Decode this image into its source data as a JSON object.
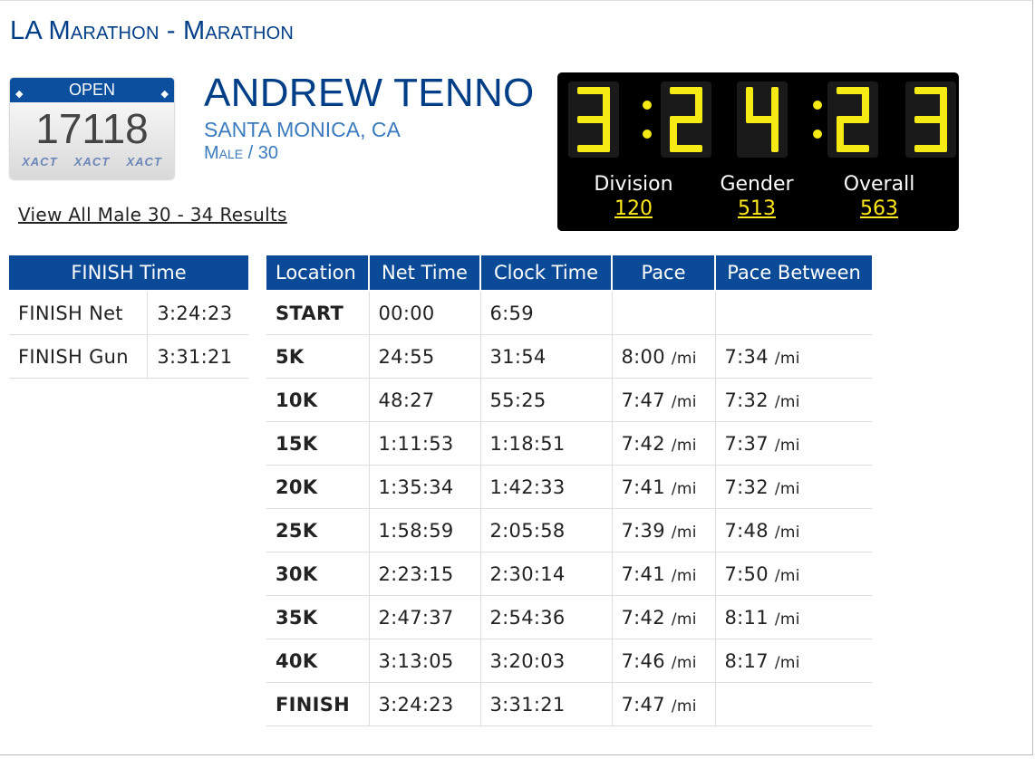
{
  "race": {
    "title": "LA Marathon - Marathon"
  },
  "bib": {
    "category": "OPEN",
    "number": "17118",
    "logos": [
      "XACT",
      "XACT",
      "XACT"
    ]
  },
  "runner": {
    "name": "ANDREW TENNO",
    "city": "SANTA MONICA, CA",
    "info": "Male / 30",
    "view_all_link": "View All Male 30 - 34 Results"
  },
  "clock": {
    "time": "3:24:23",
    "digits": [
      "3",
      "2",
      "4",
      "2",
      "3"
    ],
    "colors": {
      "segment": "#f5ea14",
      "background": "#000000",
      "rank_value": "#ffe81a"
    }
  },
  "ranks": [
    {
      "label": "Division",
      "value": "120"
    },
    {
      "label": "Gender",
      "value": "513"
    },
    {
      "label": "Overall",
      "value": "563"
    }
  ],
  "finish_time": {
    "header": "FINISH Time",
    "rows": [
      {
        "label": "FINISH Net",
        "value": "3:24:23"
      },
      {
        "label": "FINISH Gun",
        "value": "3:31:21"
      }
    ]
  },
  "splits": {
    "headers": [
      "Location",
      "Net Time",
      "Clock Time",
      "Pace",
      "Pace Between"
    ],
    "unit": "/mi",
    "rows": [
      {
        "location": "START",
        "net": "00:00",
        "clock": "6:59",
        "pace": "",
        "between": ""
      },
      {
        "location": "5K",
        "net": "24:55",
        "clock": "31:54",
        "pace": "8:00",
        "between": "7:34"
      },
      {
        "location": "10K",
        "net": "48:27",
        "clock": "55:25",
        "pace": "7:47",
        "between": "7:32"
      },
      {
        "location": "15K",
        "net": "1:11:53",
        "clock": "1:18:51",
        "pace": "7:42",
        "between": "7:37"
      },
      {
        "location": "20K",
        "net": "1:35:34",
        "clock": "1:42:33",
        "pace": "7:41",
        "between": "7:32"
      },
      {
        "location": "25K",
        "net": "1:58:59",
        "clock": "2:05:58",
        "pace": "7:39",
        "between": "7:48"
      },
      {
        "location": "30K",
        "net": "2:23:15",
        "clock": "2:30:14",
        "pace": "7:41",
        "between": "7:50"
      },
      {
        "location": "35K",
        "net": "2:47:37",
        "clock": "2:54:36",
        "pace": "7:42",
        "between": "8:11"
      },
      {
        "location": "40K",
        "net": "3:13:05",
        "clock": "3:20:03",
        "pace": "7:46",
        "between": "8:17"
      },
      {
        "location": "FINISH",
        "net": "3:24:23",
        "clock": "3:31:21",
        "pace": "7:47",
        "between": ""
      }
    ]
  }
}
